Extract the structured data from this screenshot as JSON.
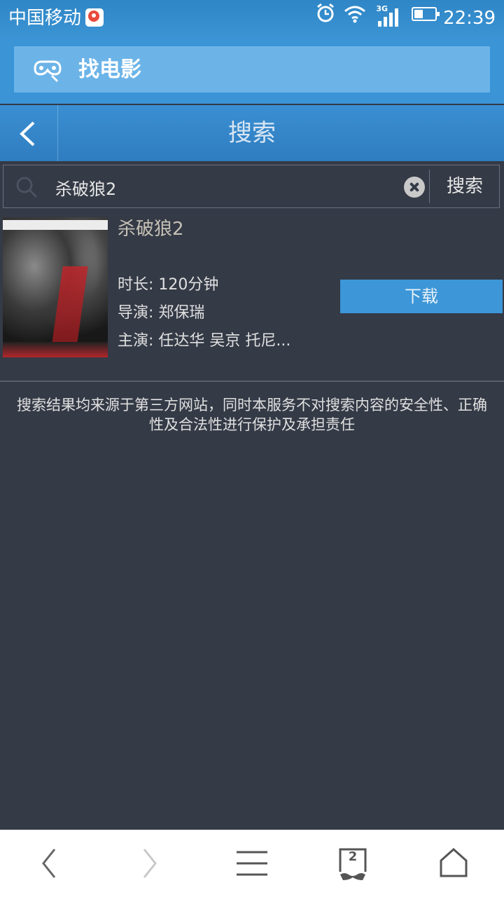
{
  "status_bar": {
    "carrier": "中国移动",
    "network": "3G",
    "time": "22:39",
    "icons": [
      "carrier-app-icon",
      "alarm-icon",
      "wifi-icon",
      "signal-icon",
      "battery-icon"
    ]
  },
  "browser": {
    "url_title": "找电影",
    "url_icon": "movie-mask-icon",
    "accent": "#3a94d6"
  },
  "header": {
    "title": "搜索",
    "back_icon": "chevron-left-icon"
  },
  "search": {
    "query": "杀破狼2",
    "button_label": "搜索",
    "clear_icon": "clear-icon"
  },
  "result": {
    "title": "杀破狼2",
    "duration": "时长: 120分钟",
    "director": "导演: 郑保瑞",
    "cast": "主演: 任达华 吴京 托尼...",
    "download_label": "下载",
    "download_color": "#3c96d8"
  },
  "disclaimer": "搜索结果均来源于第三方网站，同时本服务不对搜索内容的安全性、正确性及合法性进行保护及承担责任",
  "bottom_nav": {
    "tab_count": "2",
    "items": [
      "back-icon",
      "forward-icon",
      "menu-icon",
      "tabs-icon",
      "home-icon"
    ]
  }
}
